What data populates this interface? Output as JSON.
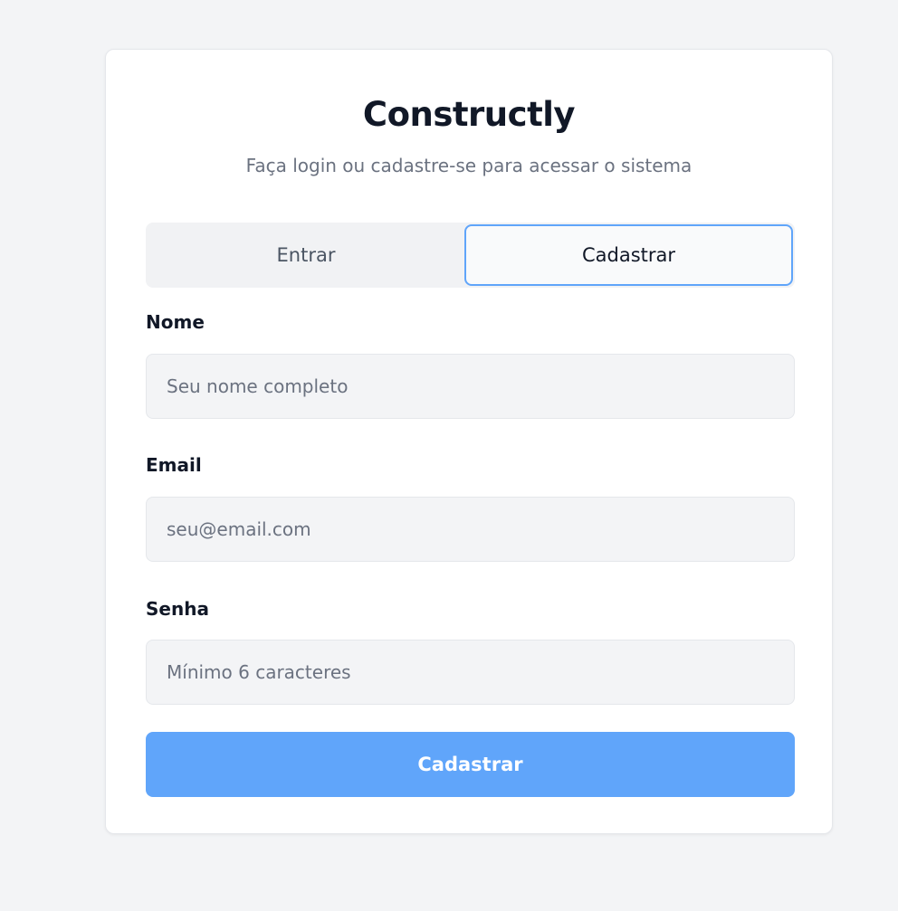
{
  "app": {
    "title": "Constructly",
    "subtitle": "Faça login ou cadastre-se para acessar o sistema"
  },
  "tabs": [
    {
      "label": "Entrar",
      "active": false
    },
    {
      "label": "Cadastrar",
      "active": true
    }
  ],
  "form": {
    "name": {
      "label": "Nome",
      "value": "",
      "placeholder": "Seu nome completo"
    },
    "email": {
      "label": "Email",
      "value": "",
      "placeholder": "seu@email.com"
    },
    "password": {
      "label": "Senha",
      "value": "",
      "placeholder": "Mínimo 6 caracteres"
    },
    "submit_label": "Cadastrar"
  },
  "colors": {
    "accent": "#60a5fa",
    "background": "#f3f4f6",
    "card": "#ffffff"
  }
}
